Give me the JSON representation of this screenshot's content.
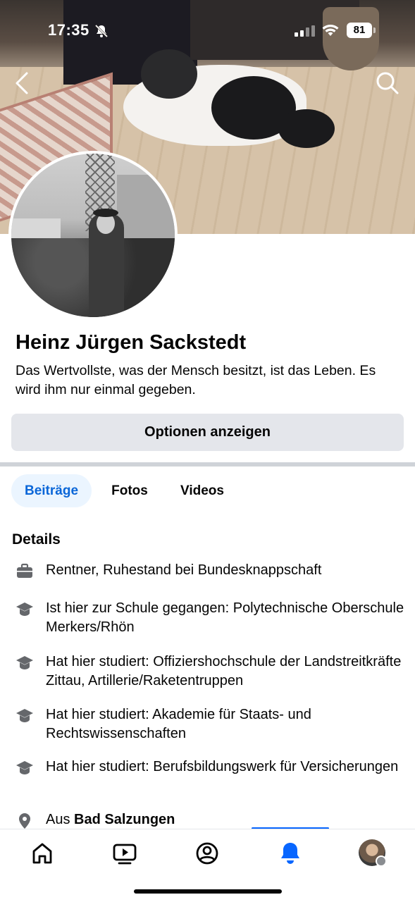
{
  "status_bar": {
    "time": "17:35",
    "battery": "81"
  },
  "profile": {
    "name": "Heinz Jürgen Sackstedt",
    "bio": "Das Wertvollste, was der Mensch besitzt, ist das Leben. Es wird ihm nur einmal gegeben.",
    "options_button": "Optionen anzeigen"
  },
  "tabs": [
    {
      "label": "Beiträge",
      "active": true
    },
    {
      "label": "Fotos",
      "active": false
    },
    {
      "label": "Videos",
      "active": false
    }
  ],
  "details": {
    "heading": "Details",
    "items": [
      {
        "icon": "briefcase-icon",
        "text": "Rentner, Ruhestand bei Bundesknappschaft"
      },
      {
        "icon": "graduation-cap-icon",
        "text": "Ist hier zur Schule gegangen: Polytechnische Oberschule Merkers/Rhön"
      },
      {
        "icon": "graduation-cap-icon",
        "text": "Hat hier studiert: Offiziershochschule der Landstreitkräfte Zittau, Artillerie/Raketentruppen"
      },
      {
        "icon": "graduation-cap-icon",
        "text": "Hat hier studiert: Akademie für Staats- und Rechtswissenschaften"
      },
      {
        "icon": "graduation-cap-icon",
        "text": "Hat hier studiert: Berufsbildungswerk für Versicherungen"
      },
      {
        "icon": "location-pin-icon",
        "prefix": "Aus ",
        "place": "Bad Salzungen"
      }
    ]
  },
  "bottom_nav": {
    "items": [
      "home-icon",
      "video-icon",
      "profile-icon",
      "notifications-bell-icon",
      "menu-avatar"
    ],
    "active": "notifications-bell-icon"
  },
  "colors": {
    "accent": "#0866ff",
    "active_tab_bg": "#ebf5ff",
    "active_tab_text": "#0a66d8",
    "button_bg": "#e4e6eb"
  }
}
